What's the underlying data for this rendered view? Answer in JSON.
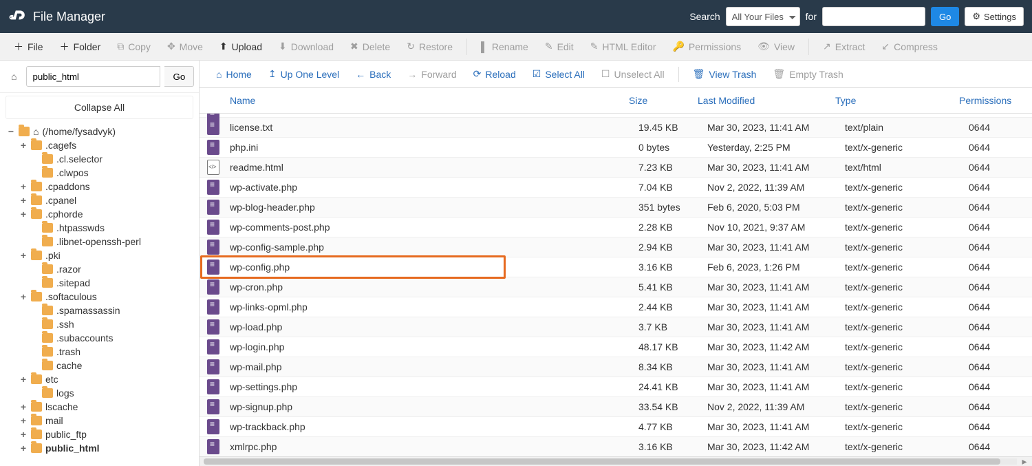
{
  "header": {
    "title": "File Manager",
    "search_label": "Search",
    "search_select": "All Your Files",
    "for_label": "for",
    "search_value": "",
    "go": "Go",
    "settings": "Settings"
  },
  "toolbar": {
    "file": "File",
    "folder": "Folder",
    "copy": "Copy",
    "move": "Move",
    "upload": "Upload",
    "download": "Download",
    "delete": "Delete",
    "restore": "Restore",
    "rename": "Rename",
    "edit": "Edit",
    "html_editor": "HTML Editor",
    "permissions": "Permissions",
    "view": "View",
    "extract": "Extract",
    "compress": "Compress"
  },
  "sidebar": {
    "path_value": "public_html",
    "go": "Go",
    "collapse": "Collapse All",
    "root_label": "(/home/fysadvyk)",
    "items": [
      {
        "label": ".cagefs",
        "level": 1,
        "expand": "+"
      },
      {
        "label": ".cl.selector",
        "level": 2,
        "expand": ""
      },
      {
        "label": ".clwpos",
        "level": 2,
        "expand": ""
      },
      {
        "label": ".cpaddons",
        "level": 1,
        "expand": "+"
      },
      {
        "label": ".cpanel",
        "level": 1,
        "expand": "+"
      },
      {
        "label": ".cphorde",
        "level": 1,
        "expand": "+"
      },
      {
        "label": ".htpasswds",
        "level": 2,
        "expand": ""
      },
      {
        "label": ".libnet-openssh-perl",
        "level": 2,
        "expand": ""
      },
      {
        "label": ".pki",
        "level": 1,
        "expand": "+"
      },
      {
        "label": ".razor",
        "level": 2,
        "expand": ""
      },
      {
        "label": ".sitepad",
        "level": 2,
        "expand": ""
      },
      {
        "label": ".softaculous",
        "level": 1,
        "expand": "+"
      },
      {
        "label": ".spamassassin",
        "level": 2,
        "expand": ""
      },
      {
        "label": ".ssh",
        "level": 2,
        "expand": ""
      },
      {
        "label": ".subaccounts",
        "level": 2,
        "expand": ""
      },
      {
        "label": ".trash",
        "level": 2,
        "expand": ""
      },
      {
        "label": "cache",
        "level": 2,
        "expand": ""
      },
      {
        "label": "etc",
        "level": 1,
        "expand": "+"
      },
      {
        "label": "logs",
        "level": 2,
        "expand": ""
      },
      {
        "label": "lscache",
        "level": 1,
        "expand": "+"
      },
      {
        "label": "mail",
        "level": 1,
        "expand": "+"
      },
      {
        "label": "public_ftp",
        "level": 1,
        "expand": "+"
      },
      {
        "label": "public_html",
        "level": 1,
        "expand": "+",
        "bold": true
      }
    ]
  },
  "actionbar": {
    "home": "Home",
    "up": "Up One Level",
    "back": "Back",
    "forward": "Forward",
    "reload": "Reload",
    "select_all": "Select All",
    "unselect_all": "Unselect All",
    "view_trash": "View Trash",
    "empty_trash": "Empty Trash"
  },
  "columns": {
    "name": "Name",
    "size": "Size",
    "modified": "Last Modified",
    "type": "Type",
    "permissions": "Permissions"
  },
  "files": [
    {
      "name": "license.txt",
      "size": "19.45 KB",
      "modified": "Mar 30, 2023, 11:41 AM",
      "type": "text/plain",
      "perm": "0644",
      "icon": "doc"
    },
    {
      "name": "php.ini",
      "size": "0 bytes",
      "modified": "Yesterday, 2:25 PM",
      "type": "text/x-generic",
      "perm": "0644",
      "icon": "doc"
    },
    {
      "name": "readme.html",
      "size": "7.23 KB",
      "modified": "Mar 30, 2023, 11:41 AM",
      "type": "text/html",
      "perm": "0644",
      "icon": "html"
    },
    {
      "name": "wp-activate.php",
      "size": "7.04 KB",
      "modified": "Nov 2, 2022, 11:39 AM",
      "type": "text/x-generic",
      "perm": "0644",
      "icon": "doc"
    },
    {
      "name": "wp-blog-header.php",
      "size": "351 bytes",
      "modified": "Feb 6, 2020, 5:03 PM",
      "type": "text/x-generic",
      "perm": "0644",
      "icon": "doc"
    },
    {
      "name": "wp-comments-post.php",
      "size": "2.28 KB",
      "modified": "Nov 10, 2021, 9:37 AM",
      "type": "text/x-generic",
      "perm": "0644",
      "icon": "doc"
    },
    {
      "name": "wp-config-sample.php",
      "size": "2.94 KB",
      "modified": "Mar 30, 2023, 11:41 AM",
      "type": "text/x-generic",
      "perm": "0644",
      "icon": "doc"
    },
    {
      "name": "wp-config.php",
      "size": "3.16 KB",
      "modified": "Feb 6, 2023, 1:26 PM",
      "type": "text/x-generic",
      "perm": "0644",
      "icon": "doc",
      "highlight": true
    },
    {
      "name": "wp-cron.php",
      "size": "5.41 KB",
      "modified": "Mar 30, 2023, 11:41 AM",
      "type": "text/x-generic",
      "perm": "0644",
      "icon": "doc"
    },
    {
      "name": "wp-links-opml.php",
      "size": "2.44 KB",
      "modified": "Mar 30, 2023, 11:41 AM",
      "type": "text/x-generic",
      "perm": "0644",
      "icon": "doc"
    },
    {
      "name": "wp-load.php",
      "size": "3.7 KB",
      "modified": "Mar 30, 2023, 11:41 AM",
      "type": "text/x-generic",
      "perm": "0644",
      "icon": "doc"
    },
    {
      "name": "wp-login.php",
      "size": "48.17 KB",
      "modified": "Mar 30, 2023, 11:42 AM",
      "type": "text/x-generic",
      "perm": "0644",
      "icon": "doc"
    },
    {
      "name": "wp-mail.php",
      "size": "8.34 KB",
      "modified": "Mar 30, 2023, 11:41 AM",
      "type": "text/x-generic",
      "perm": "0644",
      "icon": "doc"
    },
    {
      "name": "wp-settings.php",
      "size": "24.41 KB",
      "modified": "Mar 30, 2023, 11:41 AM",
      "type": "text/x-generic",
      "perm": "0644",
      "icon": "doc"
    },
    {
      "name": "wp-signup.php",
      "size": "33.54 KB",
      "modified": "Nov 2, 2022, 11:39 AM",
      "type": "text/x-generic",
      "perm": "0644",
      "icon": "doc"
    },
    {
      "name": "wp-trackback.php",
      "size": "4.77 KB",
      "modified": "Mar 30, 2023, 11:41 AM",
      "type": "text/x-generic",
      "perm": "0644",
      "icon": "doc"
    },
    {
      "name": "xmlrpc.php",
      "size": "3.16 KB",
      "modified": "Mar 30, 2023, 11:42 AM",
      "type": "text/x-generic",
      "perm": "0644",
      "icon": "doc"
    }
  ]
}
